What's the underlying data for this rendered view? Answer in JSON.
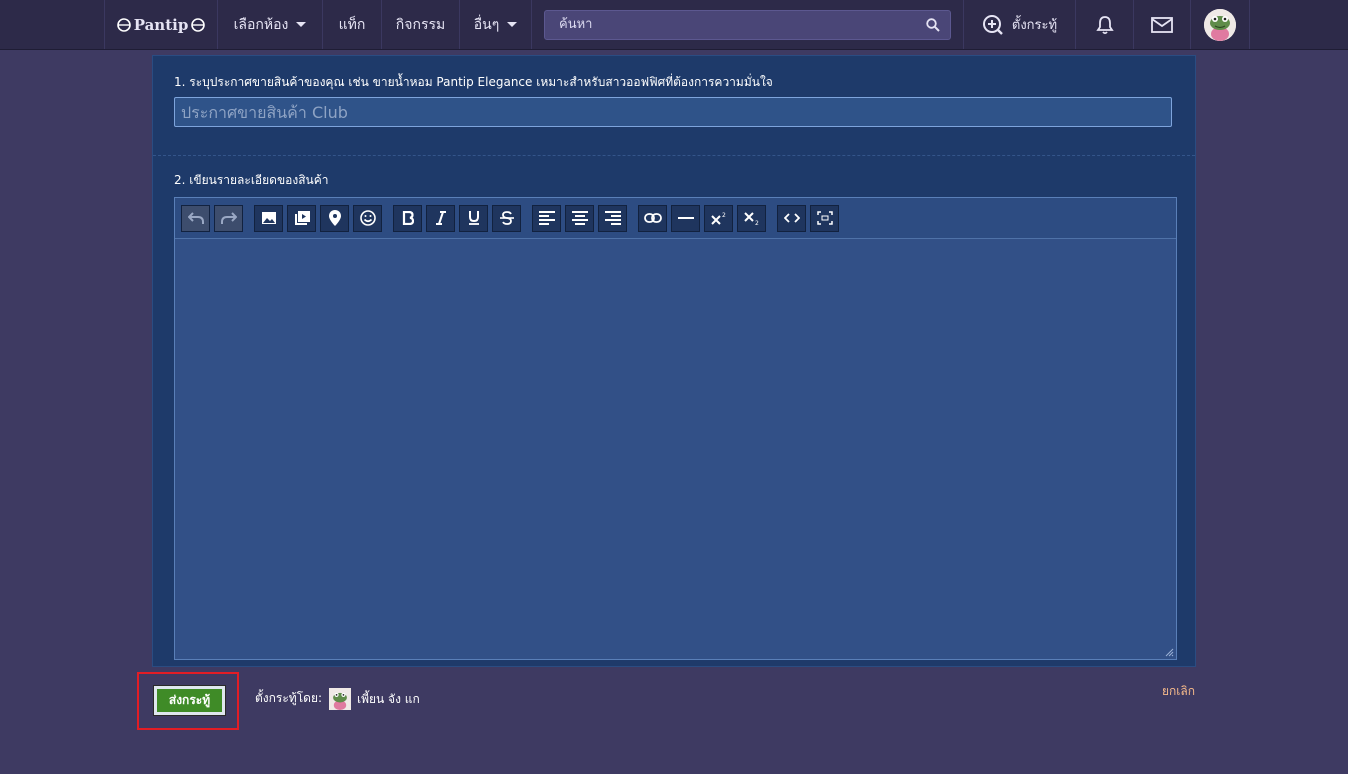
{
  "nav": {
    "logo": "Pantip",
    "rooms": "เลือกห้อง",
    "tag": "แท็ก",
    "activity": "กิจกรรม",
    "more": "อื่นๆ",
    "search_placeholder": "ค้นหา",
    "new_topic": "ตั้งกระทู้"
  },
  "form": {
    "step1_label": "1. ระบุประกาศขายสินค้าของคุณ เช่น ขายน้ำหอม Pantip Elegance เหมาะสำหรับสาวออฟฟิศที่ต้องการความมั่นใจ",
    "title_placeholder": "ประกาศขายสินค้า Club",
    "step2_label": "2. เขียนรายละเอียดของสินค้า"
  },
  "toolbar": {
    "buttons": [
      "undo-icon",
      "redo-icon",
      "image-icon",
      "video-icon",
      "location-icon",
      "emoji-icon",
      "bold-icon",
      "italic-icon",
      "underline-icon",
      "strikethrough-icon",
      "align-left-icon",
      "align-center-icon",
      "align-right-icon",
      "link-icon",
      "horizontal-rule-icon",
      "superscript-icon",
      "subscript-icon",
      "code-icon",
      "fullscreen-icon"
    ]
  },
  "footer": {
    "submit": "ส่งกระทู้",
    "author_label": "ตั้งกระทู้โดย:",
    "author_name": "เพี้ยน จัง แก",
    "cancel": "ยกเลิก"
  },
  "colors": {
    "page_bg": "#3e3a62",
    "nav_bg": "#2d2a49",
    "panel_bg": "#1e3a6a",
    "submit_bg": "#3f8b27",
    "highlight": "#e11d25",
    "cancel": "#f5b98a"
  }
}
